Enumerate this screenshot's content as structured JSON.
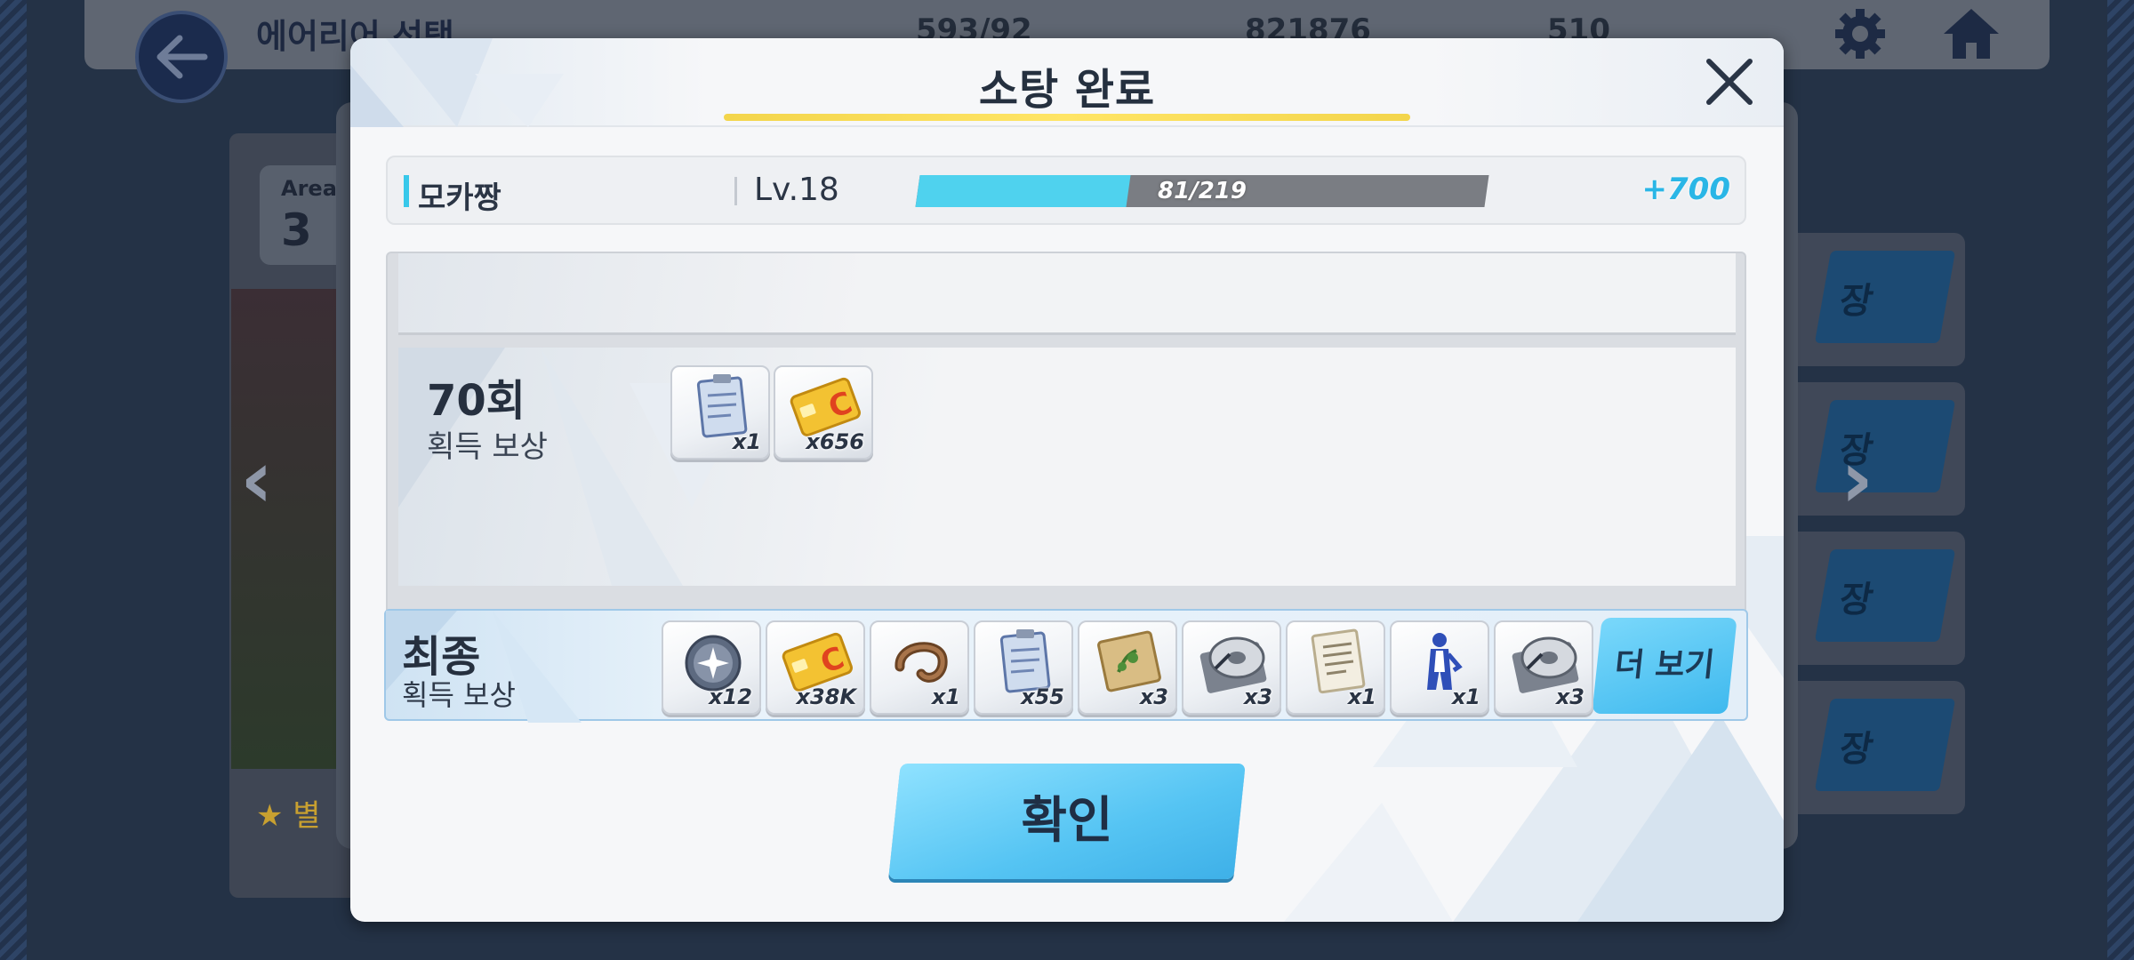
{
  "background": {
    "title": "에어리어 선택",
    "stats": [
      "593/92",
      "821876",
      "510"
    ],
    "area_label": "Area",
    "area_number": "3",
    "side_card_label": "장",
    "star_label": "별"
  },
  "modal": {
    "title": "소탕 완료",
    "close_icon": "close-icon"
  },
  "level": {
    "character_name": "모카짱",
    "level": "Lv.18",
    "exp_current": 81,
    "exp_max": 219,
    "exp_text": "81/219",
    "exp_gain": "+700"
  },
  "round_reward": {
    "round": "70회",
    "label": "획득 보상",
    "items": [
      {
        "icon": "clipboard-icon",
        "qty": "x1"
      },
      {
        "icon": "gold-card-icon",
        "qty": "x656"
      }
    ]
  },
  "final_reward": {
    "title": "최종",
    "label": "획득 보상",
    "items": [
      {
        "icon": "crystal-orb-icon",
        "qty": "x12"
      },
      {
        "icon": "gold-card-icon",
        "qty": "x38K"
      },
      {
        "icon": "horseshoe-icon",
        "qty": "x1"
      },
      {
        "icon": "clipboard-icon",
        "qty": "x55"
      },
      {
        "icon": "map-scroll-icon",
        "qty": "x3"
      },
      {
        "icon": "disc-icon",
        "qty": "x3"
      },
      {
        "icon": "document-icon",
        "qty": "x1"
      },
      {
        "icon": "blue-figure-icon",
        "qty": "x1"
      },
      {
        "icon": "disc-icon",
        "qty": "x3"
      }
    ],
    "more_label": "더 보기"
  },
  "confirm_label": "확인",
  "colors": {
    "accent": "#4fd2ee",
    "title_underline": "#ffe566",
    "button": "#55c4f3",
    "exp_gain": "#2ab6e6"
  }
}
